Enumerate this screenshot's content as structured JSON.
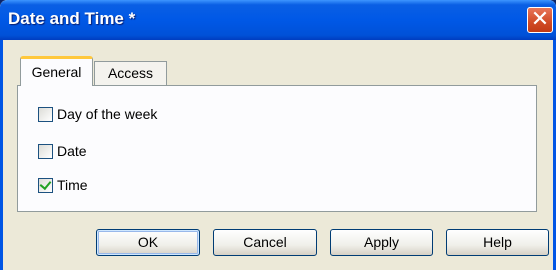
{
  "window": {
    "title": "Date and Time *",
    "close_glyph": "✕"
  },
  "tabs": [
    {
      "label": "General",
      "active": true
    },
    {
      "label": "Access",
      "active": false
    }
  ],
  "options": [
    {
      "label": "Day of the week",
      "checked": false
    },
    {
      "label": "Date",
      "checked": false
    },
    {
      "label": "Time",
      "checked": true
    }
  ],
  "buttons": {
    "ok": "OK",
    "cancel": "Cancel",
    "apply": "Apply",
    "help": "Help"
  },
  "colors": {
    "titlebar": "#0058e6",
    "close": "#d04a25",
    "tab_highlight": "#ffc83c",
    "check": "#21a121"
  }
}
